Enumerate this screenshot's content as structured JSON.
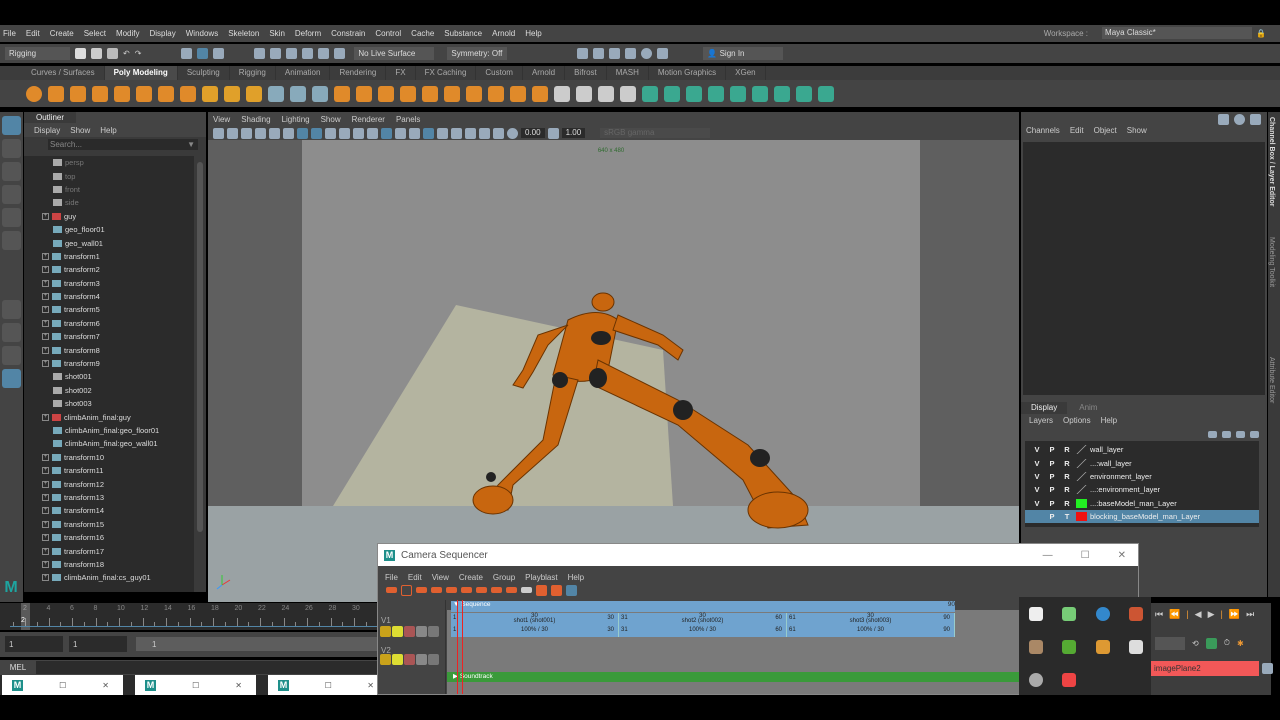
{
  "menubar": {
    "items": [
      "File",
      "Edit",
      "Create",
      "Select",
      "Modify",
      "Display",
      "Windows",
      "Skeleton",
      "Skin",
      "Deform",
      "Constrain",
      "Control",
      "Cache",
      "Substance",
      "Arnold",
      "Help"
    ],
    "workspace_label": "Workspace :",
    "workspace_value": "Maya Classic*"
  },
  "status": {
    "mode": "Rigging",
    "live_surface": "No Live Surface",
    "symmetry": "Symmetry: Off",
    "sign_in": "Sign In"
  },
  "shelf_tabs": [
    "Curves / Surfaces",
    "Poly Modeling",
    "Sculpting",
    "Rigging",
    "Animation",
    "Rendering",
    "FX",
    "FX Caching",
    "Custom",
    "Arnold",
    "Bifrost",
    "MASH",
    "Motion Graphics",
    "XGen"
  ],
  "shelf_active": "Poly Modeling",
  "outliner": {
    "tab": "Outliner",
    "menu": [
      "Display",
      "Show",
      "Help"
    ],
    "search_placeholder": "Search...",
    "items": [
      {
        "name": "persp",
        "dim": true,
        "exp": false
      },
      {
        "name": "top",
        "dim": true,
        "exp": false
      },
      {
        "name": "front",
        "dim": true,
        "exp": false
      },
      {
        "name": "side",
        "dim": true,
        "exp": false
      },
      {
        "name": "guy",
        "exp": true
      },
      {
        "name": "geo_floor01",
        "exp": false
      },
      {
        "name": "geo_wall01",
        "exp": false
      },
      {
        "name": "transform1",
        "exp": true
      },
      {
        "name": "transform2",
        "exp": true
      },
      {
        "name": "transform3",
        "exp": true
      },
      {
        "name": "transform4",
        "exp": true
      },
      {
        "name": "transform5",
        "exp": true
      },
      {
        "name": "transform6",
        "exp": true
      },
      {
        "name": "transform7",
        "exp": true
      },
      {
        "name": "transform8",
        "exp": true
      },
      {
        "name": "transform9",
        "exp": true
      },
      {
        "name": "shot001",
        "exp": false
      },
      {
        "name": "shot002",
        "exp": false
      },
      {
        "name": "shot003",
        "exp": false
      },
      {
        "name": "climbAnim_final:guy",
        "exp": true
      },
      {
        "name": "climbAnim_final:geo_floor01",
        "exp": false
      },
      {
        "name": "climbAnim_final:geo_wall01",
        "exp": false
      },
      {
        "name": "transform10",
        "exp": true
      },
      {
        "name": "transform11",
        "exp": true
      },
      {
        "name": "transform12",
        "exp": true
      },
      {
        "name": "transform13",
        "exp": true
      },
      {
        "name": "transform14",
        "exp": true
      },
      {
        "name": "transform15",
        "exp": true
      },
      {
        "name": "transform16",
        "exp": true
      },
      {
        "name": "transform17",
        "exp": true
      },
      {
        "name": "transform18",
        "exp": true
      },
      {
        "name": "climbAnim_final:cs_guy01",
        "exp": true
      }
    ]
  },
  "viewport": {
    "menu": [
      "View",
      "Shading",
      "Lighting",
      "Show",
      "Renderer",
      "Panels"
    ],
    "exposure": "0.00",
    "gamma": "1.00",
    "color_space": "sRGB gamma",
    "resolution": "640 x 480"
  },
  "channel_box": {
    "menu": [
      "Channels",
      "Edit",
      "Object",
      "Show"
    ]
  },
  "side_tabs": [
    "Channel Box / Layer Editor",
    "Modeling Toolkit",
    "Attribute Editor"
  ],
  "layer_editor": {
    "tabs": [
      "Display",
      "Anim"
    ],
    "menu": [
      "Layers",
      "Options",
      "Help"
    ],
    "layers": [
      {
        "v": "V",
        "p": "P",
        "r": "R",
        "name": "wall_layer",
        "color": null
      },
      {
        "v": "V",
        "p": "P",
        "r": "R",
        "name": "...:wall_layer",
        "color": null
      },
      {
        "v": "V",
        "p": "P",
        "r": "R",
        "name": "environment_layer",
        "color": null
      },
      {
        "v": "V",
        "p": "P",
        "r": "R",
        "name": "...:environment_layer",
        "color": null
      },
      {
        "v": "V",
        "p": "P",
        "r": "R",
        "name": "...:baseModel_man_Layer",
        "color": "#22ee22"
      },
      {
        "v": "",
        "p": "P",
        "r": "T",
        "name": "blocking_baseModel_man_Layer",
        "color": "#ee1111",
        "selected": true
      }
    ]
  },
  "timeline": {
    "ticks": [
      "2",
      "4",
      "6",
      "8",
      "10",
      "12",
      "14",
      "16",
      "18",
      "20",
      "22",
      "24",
      "26",
      "28",
      "30"
    ],
    "current": "2",
    "range_start": "1",
    "range_start2": "1",
    "range_slider": "1"
  },
  "command_line": {
    "label": "MEL"
  },
  "taskbar": {
    "windows": [
      "M",
      "M",
      "M"
    ]
  },
  "sequencer": {
    "title": "Camera Sequencer",
    "menu": [
      "File",
      "Edit",
      "View",
      "Create",
      "Group",
      "Playblast",
      "Help"
    ],
    "sequence_label": "Sequence",
    "sequence_end": "90",
    "tracks": [
      "V1",
      "V2"
    ],
    "shots": [
      {
        "label": "shot1 (shot001)",
        "start": "1",
        "end": "30",
        "dur": "30",
        "speed": "100%  /  30"
      },
      {
        "label": "shot2 (shot002)",
        "start": "31",
        "end": "60",
        "dur": "30",
        "speed": "100%  /  30"
      },
      {
        "label": "shot3 (shot003)",
        "start": "61",
        "end": "90",
        "dur": "30",
        "speed": "100%  /  30"
      }
    ],
    "soundtrack": "Soundtrack"
  },
  "playback": {
    "image_plane": "imagePlane2"
  },
  "colors": {
    "accent": "#5285a6",
    "shot_blue": "#6fa3cf",
    "soundtrack_green": "#3a9a3a",
    "character_orange": "#c86a12",
    "image_plane_red": "#f25858"
  }
}
